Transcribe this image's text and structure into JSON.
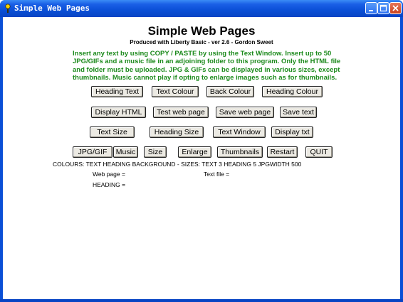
{
  "window": {
    "title": "Simple Web Pages"
  },
  "header": {
    "title": "Simple Web Pages",
    "subtitle": "Produced with Liberty Basic - ver 2.6 - Gordon Sweet"
  },
  "instructions": [
    "Insert any text by using COPY / PASTE by using the Text Window. Insert up to 50",
    "JPG/GIFs and a music file in an adjoining folder to this program. Only the HTML file",
    "and folder must be uploaded. JPG & GIFs can be displayed in various sizes, except",
    "thumbnails. Music cannot play if opting to enlarge images such as for thumbnails."
  ],
  "buttons": {
    "row1": [
      "Heading Text",
      "Text Colour",
      "Back Colour",
      "Heading Colour"
    ],
    "row2": [
      "Display HTML",
      "Test web page",
      "Save web page",
      "Save text"
    ],
    "row3": [
      "Text Size",
      "Heading Size",
      "Text Window",
      "Display txt"
    ],
    "row4": [
      "JPG/GIF",
      "Music",
      "Size",
      "Enlarge",
      "Thumbnails",
      "Restart",
      "QUIT"
    ]
  },
  "status": {
    "colours_line": "COLOURS: TEXT HEADING BACKGROUND - SIZES: TEXT 3 HEADING 5 JPGWIDTH 500",
    "web_page": "Web page =",
    "text_file": "Text file =",
    "heading": "HEADING ="
  },
  "colors": {
    "titlebar": "#0a4fd6",
    "instruction_text": "#1c8a1c",
    "button_face": "#eceae3"
  }
}
